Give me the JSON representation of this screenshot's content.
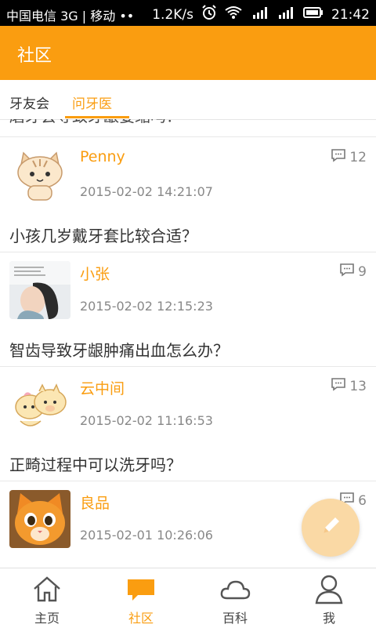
{
  "status_bar": {
    "carrier": "中国电信 3G | 移动 ••",
    "speed": "1.2K/s",
    "time": "21:42"
  },
  "app_bar": {
    "title": "社区"
  },
  "tabs": [
    {
      "label": "牙友会",
      "active": false
    },
    {
      "label": "问牙医",
      "active": true
    }
  ],
  "list": {
    "cut_off_question": "磨牙会导致牙龈萎缩吗？",
    "posts": [
      {
        "author": "Penny",
        "time": "2015-02-02 14:21:07",
        "comments": "12",
        "question": "小孩几岁戴牙套比较合适？",
        "avatar": "cat-cartoon-avatar"
      },
      {
        "author": "小张",
        "time": "2015-02-02 12:15:23",
        "comments": "9",
        "question": "智齿导致牙龈肿痛出血怎么办？",
        "avatar": "girl-photo-avatar"
      },
      {
        "author": "云中间",
        "time": "2015-02-02 11:16:53",
        "comments": "13",
        "question": "正畸过程中可以洗牙吗？",
        "avatar": "pig-cartoon-avatar"
      },
      {
        "author": "良品",
        "time": "2015-02-01 10:26:06",
        "comments": "6",
        "question": "",
        "avatar": "orange-cat-avatar"
      }
    ]
  },
  "bottom_nav": [
    {
      "label": "主页",
      "icon": "home-icon",
      "active": false
    },
    {
      "label": "社区",
      "icon": "chat-bubble-icon",
      "active": true
    },
    {
      "label": "百科",
      "icon": "cloud-icon",
      "active": false
    },
    {
      "label": "我",
      "icon": "person-icon",
      "active": false
    }
  ],
  "colors": {
    "accent": "#fa9d10",
    "fab": "#fad9a5"
  }
}
